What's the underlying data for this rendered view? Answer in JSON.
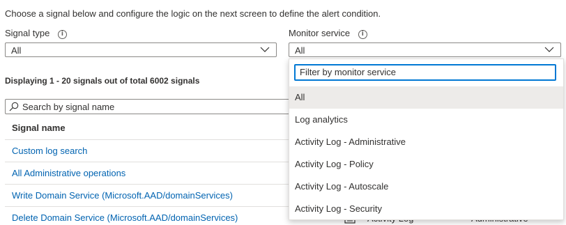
{
  "intro_text": "Choose a signal below and configure the logic on the next screen to define the alert condition.",
  "signal_type": {
    "label": "Signal type",
    "value": "All"
  },
  "monitor_service": {
    "label": "Monitor service",
    "value": "All"
  },
  "counts_text": "Displaying 1 - 20 signals out of total 6002 signals",
  "search": {
    "placeholder": "Search by signal name"
  },
  "table": {
    "header": "Signal name",
    "rows": [
      "Custom log search",
      "All Administrative operations",
      "Write Domain Service (Microsoft.AAD/domainServices)",
      "Delete Domain Service (Microsoft.AAD/domainServices)"
    ],
    "partial_row": {
      "type": "Activity Log",
      "category": "Administrative"
    }
  },
  "dropdown": {
    "filter_placeholder": "Filter by monitor service",
    "options": [
      "All",
      "Log analytics",
      "Activity Log - Administrative",
      "Activity Log - Policy",
      "Activity Log - Autoscale",
      "Activity Log - Security"
    ],
    "selected": "All"
  },
  "colors": {
    "link": "#0063b1",
    "focus_border": "#0078d4",
    "selected_bg": "#edebe9"
  }
}
